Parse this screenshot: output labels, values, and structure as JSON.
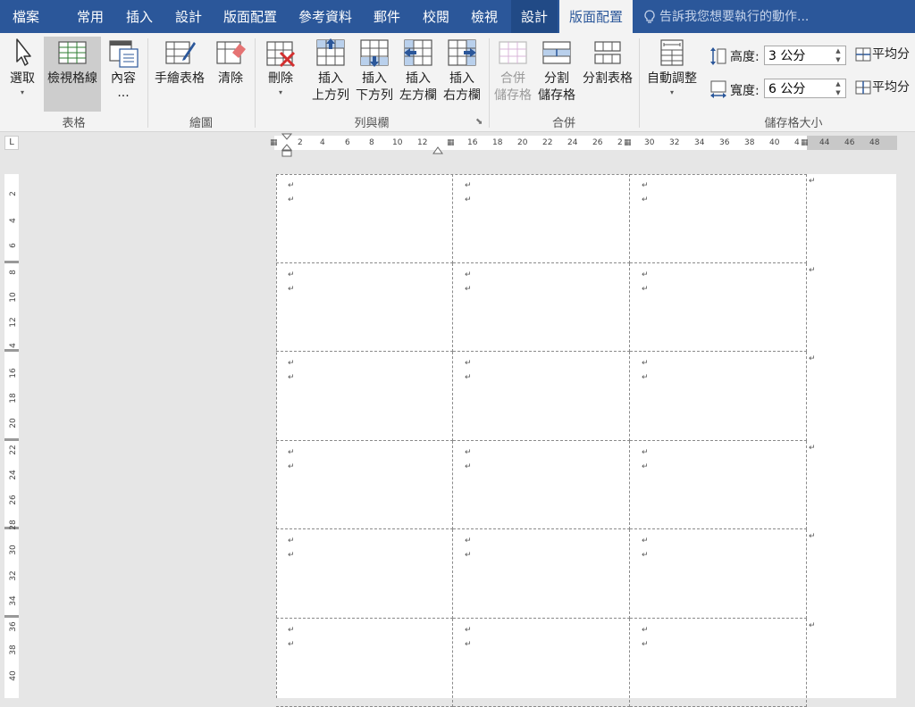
{
  "tabs": [
    "檔案",
    "常用",
    "插入",
    "設計",
    "版面配置",
    "參考資料",
    "郵件",
    "校閱",
    "檢視",
    "設計",
    "版面配置"
  ],
  "active_tab": "版面配置",
  "tell_me": "告訴我您想要執行的動作...",
  "ribbon": {
    "table_group": {
      "label": "表格",
      "select": "選取",
      "view_gridlines": "檢視格線",
      "properties": "內容",
      "properties_more": "..."
    },
    "draw_group": {
      "label": "繪圖",
      "draw_table": "手繪表格",
      "eraser": "清除"
    },
    "rows_cols_group": {
      "label": "列與欄",
      "delete": "刪除",
      "insert_above": [
        "插入",
        "上方列"
      ],
      "insert_below": [
        "插入",
        "下方列"
      ],
      "insert_left": [
        "插入",
        "左方欄"
      ],
      "insert_right": [
        "插入",
        "右方欄"
      ]
    },
    "merge_group": {
      "label": "合併",
      "merge_cells": [
        "合併",
        "儲存格"
      ],
      "split_cells": [
        "分割",
        "儲存格"
      ],
      "split_table": "分割表格"
    },
    "cell_size_group": {
      "label": "儲存格大小",
      "autofit": "自動調整",
      "height_label": "高度:",
      "height_value": "3 公分",
      "width_label": "寬度:",
      "width_value": "6 公分",
      "distribute_rows": "平均分",
      "distribute_cols": "平均分"
    }
  },
  "ruler": {
    "horizontal": [
      "2",
      "4",
      "6",
      "8",
      "10",
      "12",
      "16",
      "18",
      "20",
      "22",
      "24",
      "26",
      "2",
      "30",
      "32",
      "34",
      "36",
      "38",
      "40",
      "4",
      "44",
      "46",
      "48"
    ],
    "vertical": [
      "2",
      "4",
      "6",
      "8",
      "10",
      "12",
      "4",
      "16",
      "18",
      "20",
      "22",
      "24",
      "26",
      "28",
      "30",
      "32",
      "34",
      "36",
      "38",
      "40"
    ],
    "tab_selector": "L"
  },
  "document": {
    "rows": 6,
    "cols": 3,
    "paragraph_mark": "↵"
  }
}
